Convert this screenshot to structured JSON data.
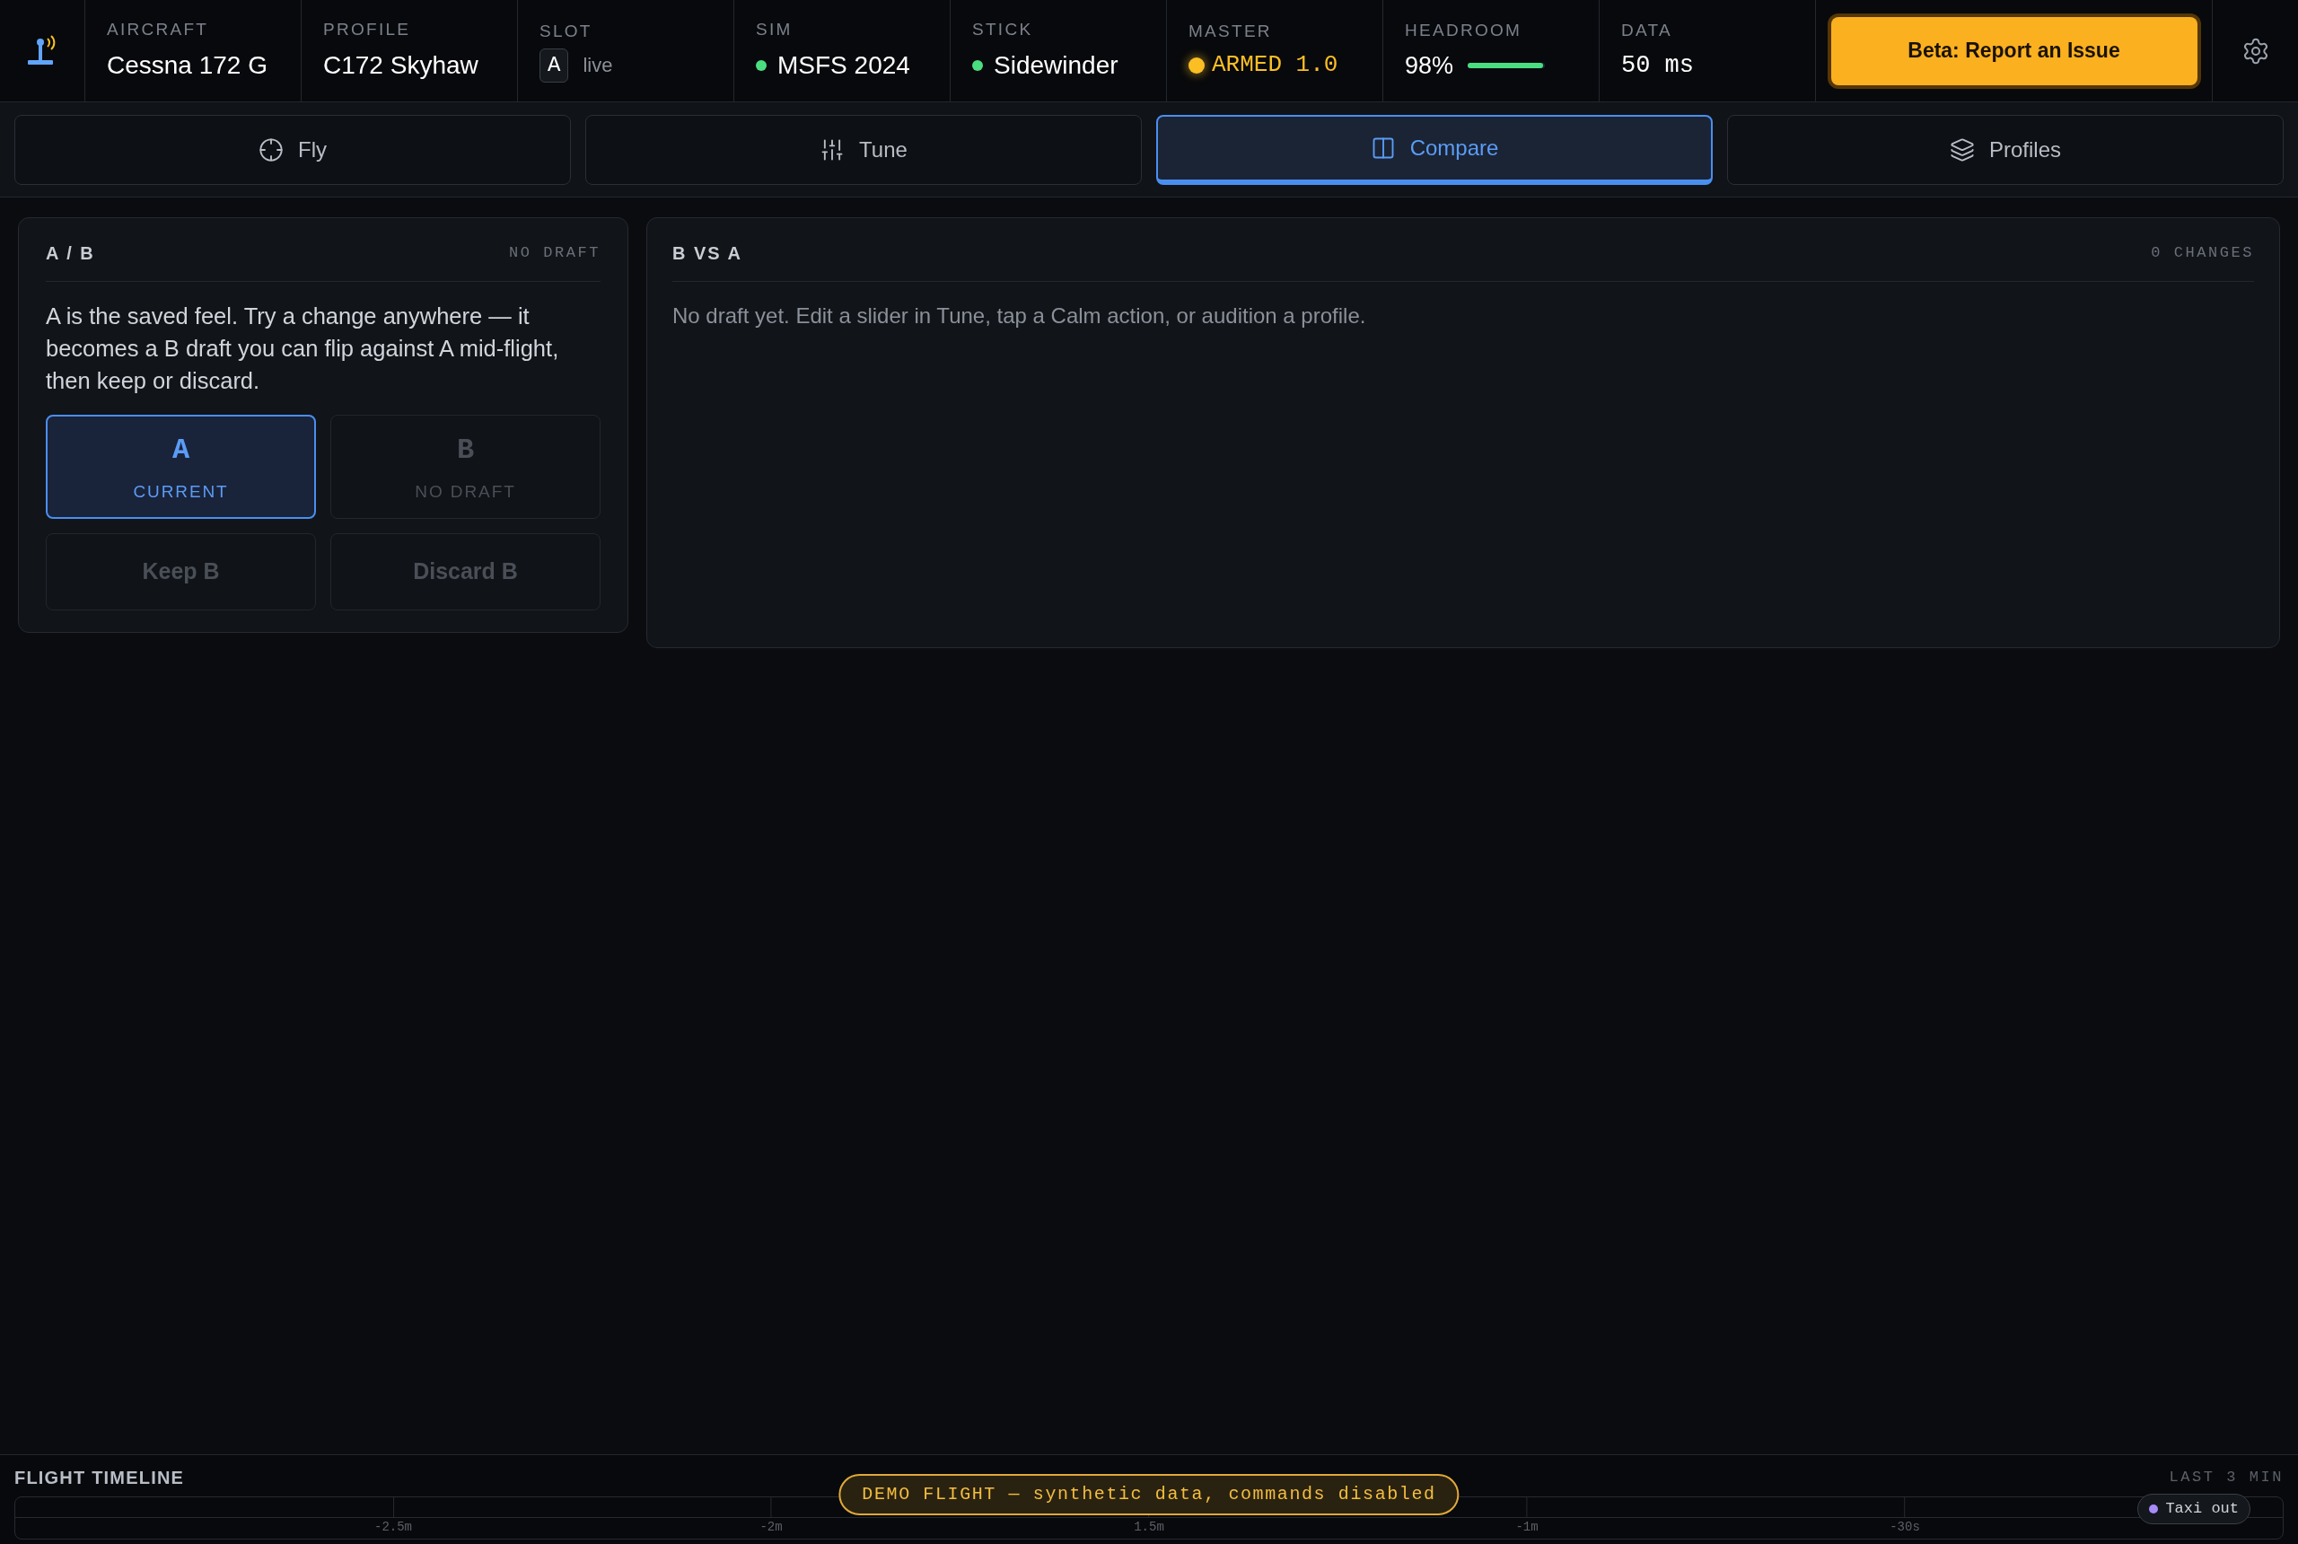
{
  "header": {
    "cells": [
      {
        "kind": "text",
        "label": "AIRCRAFT",
        "value": "Cessna 172 G"
      },
      {
        "kind": "text",
        "label": "PROFILE",
        "value": "C172 Skyhaw"
      },
      {
        "kind": "slot",
        "label": "SLOT",
        "slot": "A",
        "value": "live"
      },
      {
        "kind": "status",
        "label": "SIM",
        "value": "MSFS 2024",
        "color": "#4ade80"
      },
      {
        "kind": "status",
        "label": "STICK",
        "value": "Sidewinder",
        "color": "#4ade80"
      },
      {
        "kind": "master",
        "label": "MASTER",
        "value": "ARMED 1.0"
      },
      {
        "kind": "meter",
        "label": "HEADROOM",
        "value": "98%",
        "level": 0.98
      },
      {
        "kind": "mono",
        "label": "DATA",
        "value": "50 ms"
      }
    ],
    "report_button": "Beta: Report an Issue"
  },
  "tabs": [
    {
      "label": "Fly",
      "selected": false
    },
    {
      "label": "Tune",
      "selected": false
    },
    {
      "label": "Compare",
      "selected": true
    },
    {
      "label": "Profiles",
      "selected": false
    }
  ],
  "ab_card": {
    "title": "A / B",
    "status": "NO DRAFT",
    "text": "A is the saved feel. Try a change anywhere — it becomes a B draft you can flip against A mid-flight, then keep or discard.",
    "options": [
      {
        "letter": "A",
        "caption": "CURRENT",
        "selected": true,
        "disabled": false
      },
      {
        "letter": "B",
        "caption": "NO DRAFT",
        "selected": false,
        "disabled": true
      }
    ],
    "actions": [
      {
        "label": "Keep B",
        "disabled": true
      },
      {
        "label": "Discard B",
        "disabled": true
      }
    ]
  },
  "compare_card": {
    "title": "B VS A",
    "status": "0 CHANGES",
    "message": "No draft yet. Edit a slider in Tune, tap a Calm action, or audition a profile."
  },
  "timeline": {
    "title": "FLIGHT TIMELINE",
    "range": "LAST 3 MIN",
    "ticks": [
      "-2.5m",
      "-2m",
      "1.5m",
      "-1m",
      "-30s"
    ],
    "banner": "DEMO FLIGHT — synthetic data, commands disabled",
    "event": {
      "label": "Taxi out",
      "color": "#a78bfa"
    }
  }
}
